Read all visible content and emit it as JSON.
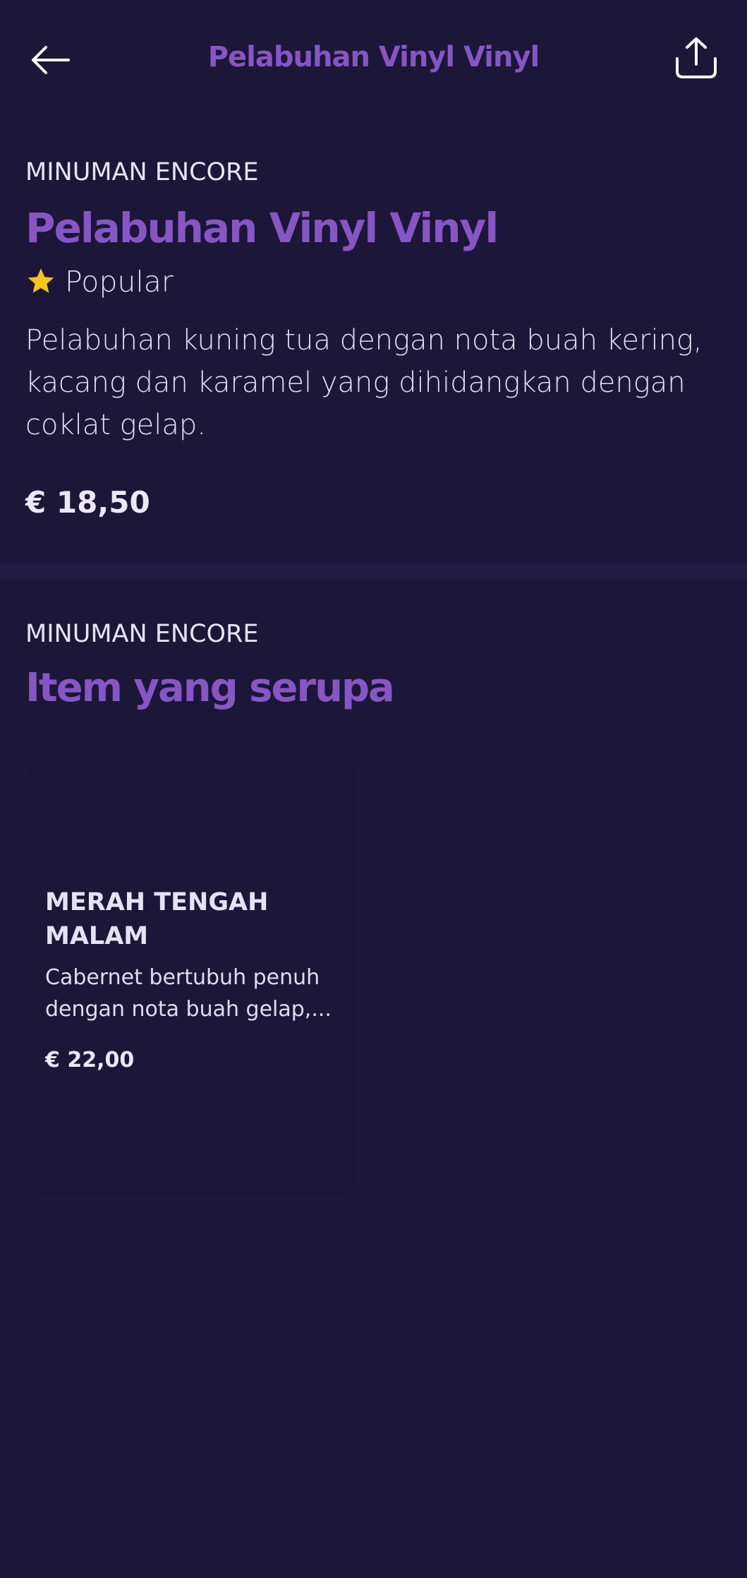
{
  "header": {
    "title": "Pelabuhan Vinyl Vinyl",
    "back_icon": "arrow-left-icon",
    "share_icon": "share-icon"
  },
  "product": {
    "category": "MINUMAN ENCORE",
    "name": "Pelabuhan Vinyl Vinyl",
    "badge": "Popular",
    "badge_icon": "star-icon",
    "description": "Pelabuhan kuning tua dengan nota buah kering, kacang dan karamel yang dihidangkan dengan coklat gelap.",
    "price": "€ 18,50"
  },
  "similar": {
    "category": "MINUMAN ENCORE",
    "title": "Item yang serupa",
    "items": [
      {
        "name": "MERAH TENGAH MALAM",
        "description": "Cabernet bertubuh penuh dengan nota buah gelap,...",
        "price": "€ 22,00"
      }
    ]
  },
  "colors": {
    "background": "#1c1638",
    "accent": "#8656c4",
    "star": "#f5c518",
    "text": "#e9e4f5"
  }
}
